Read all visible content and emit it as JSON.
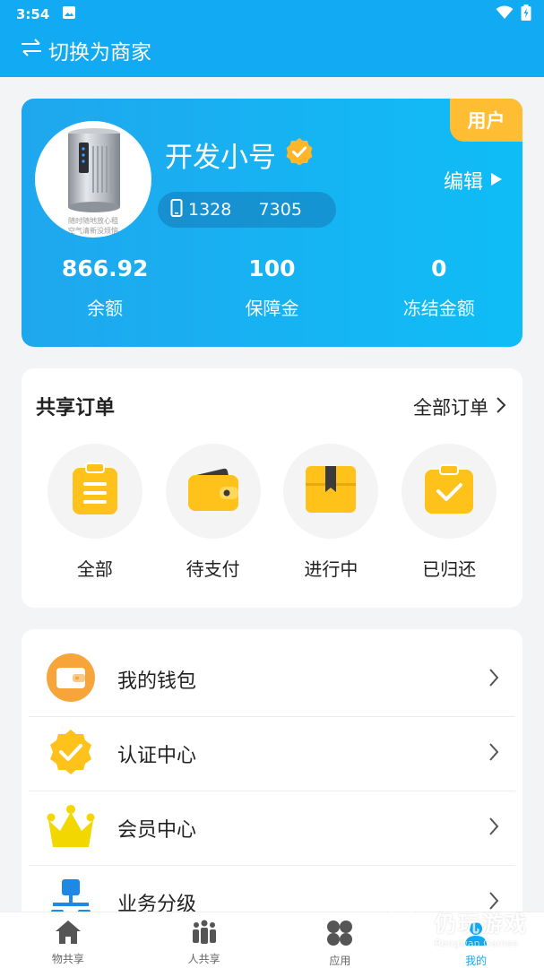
{
  "status_bar": {
    "time": "3:54"
  },
  "header": {
    "title": "切换为商家"
  },
  "profile": {
    "role_tag": "用户",
    "nickname": "开发小号",
    "edit_label": "编辑",
    "phone": "1328     7305",
    "avatar_caption_1": "随时随地放心租",
    "avatar_caption_2": "空气清新没烦恼",
    "stats": [
      {
        "value": "866.92",
        "label": "余额"
      },
      {
        "value": "100",
        "label": "保障金"
      },
      {
        "value": "0",
        "label": "冻结金额"
      }
    ]
  },
  "orders": {
    "title": "共享订单",
    "all_label": "全部订单",
    "items": [
      {
        "label": "全部",
        "icon": "clipboard-list-icon"
      },
      {
        "label": "待支付",
        "icon": "wallet-icon"
      },
      {
        "label": "进行中",
        "icon": "box-icon"
      },
      {
        "label": "已归还",
        "icon": "clipboard-check-icon"
      }
    ]
  },
  "menu": {
    "items": [
      {
        "label": "我的钱包",
        "icon": "wallet-icon"
      },
      {
        "label": "认证中心",
        "icon": "verified-badge-icon"
      },
      {
        "label": "会员中心",
        "icon": "crown-icon"
      },
      {
        "label": "业务分级",
        "icon": "org-chart-icon"
      }
    ]
  },
  "tabbar": {
    "items": [
      {
        "label": "物共享",
        "icon": "home-icon"
      },
      {
        "label": "人共享",
        "icon": "people-icon"
      },
      {
        "label": "应用",
        "icon": "apps-icon"
      },
      {
        "label": "我的",
        "icon": "profile-icon"
      }
    ],
    "active_index": 3
  },
  "watermark": {
    "name": "仍玩游戏",
    "sub": "Rengwan Games"
  },
  "colors": {
    "primary": "#12aaf2",
    "accent_yellow": "#ffc21a",
    "role_tag": "#ffbd33"
  }
}
